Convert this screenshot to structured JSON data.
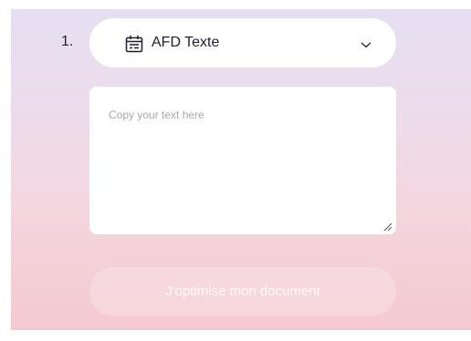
{
  "step": {
    "number": "1."
  },
  "document_select": {
    "selected": "AFD Texte",
    "icon": "calendar-document-icon",
    "chevron_icon": "chevron-down-icon"
  },
  "text_input": {
    "placeholder": "Copy your text here",
    "value": ""
  },
  "submit_button": {
    "label": "J'optimise mon document",
    "state": "disabled"
  },
  "colors": {
    "background_top": "#e6dff2",
    "background_bottom": "#f5c9cf",
    "card": "#ffffff",
    "text": "#1f1f2e",
    "placeholder": "#a8a8b0"
  }
}
